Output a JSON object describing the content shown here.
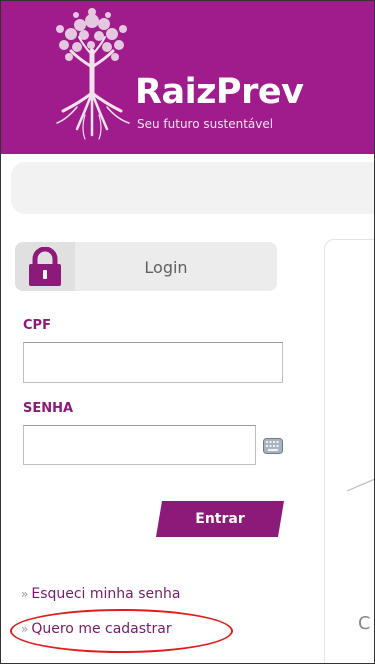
{
  "brand": {
    "name": "RaizPrev",
    "tagline": "Seu futuro sustentável",
    "header_color": "#a01c8c"
  },
  "login": {
    "title": "Login",
    "lock_icon": "lock-icon",
    "cpf_label": "CPF",
    "cpf_value": "",
    "senha_label": "SENHA",
    "senha_value": "",
    "keyboard_icon": "keyboard-icon",
    "submit_label": "Entrar"
  },
  "links": {
    "arrow": "»",
    "forgot_password": "Esqueci minha senha",
    "register": "Quero me cadastrar"
  },
  "content": {
    "partial_text": "C"
  },
  "colors": {
    "accent": "#8b1a78",
    "highlight": "#e01d1d"
  }
}
